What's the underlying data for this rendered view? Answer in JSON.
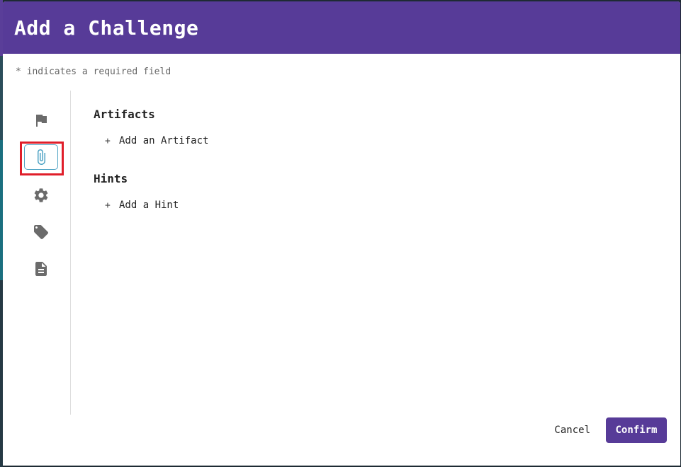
{
  "dialog": {
    "title": "Add a Challenge",
    "required_note": "* indicates a required field"
  },
  "side_nav": {
    "items": [
      {
        "icon": "flag-icon",
        "active": false
      },
      {
        "icon": "paperclip-icon",
        "active": true
      },
      {
        "icon": "gear-icon",
        "active": false
      },
      {
        "icon": "tag-icon",
        "active": false
      },
      {
        "icon": "document-icon",
        "active": false
      }
    ],
    "active_color": "#4fa3c4",
    "highlight_color": "#e01e2a"
  },
  "sections": {
    "artifacts": {
      "title": "Artifacts",
      "add_label": "Add an Artifact"
    },
    "hints": {
      "title": "Hints",
      "add_label": "Add a Hint"
    }
  },
  "footer": {
    "cancel_label": "Cancel",
    "confirm_label": "Confirm"
  },
  "colors": {
    "brand": "#573b98"
  }
}
